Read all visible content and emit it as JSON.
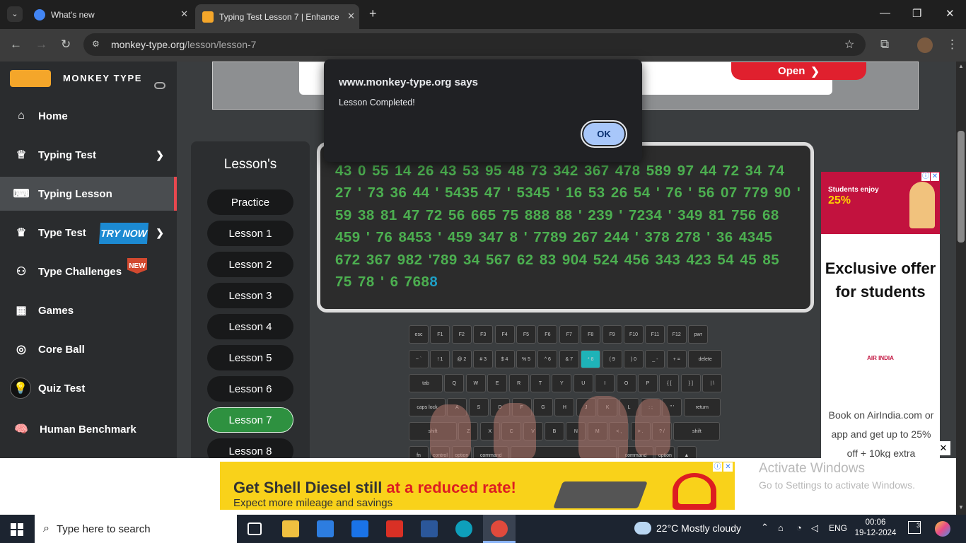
{
  "browser": {
    "tabs": [
      {
        "title": "What's new",
        "active": false
      },
      {
        "title": "Typing Test Lesson 7 | Enhance",
        "active": true
      }
    ],
    "url_host": "monkey-type.org",
    "url_path": "/lesson/lesson-7"
  },
  "sidebar": {
    "brand": "MONKEY TYPE",
    "items": [
      {
        "label": "Home",
        "icon": "home-icon"
      },
      {
        "label": "Typing Test",
        "icon": "trophy-icon"
      },
      {
        "label": "Typing Lesson",
        "icon": "keyboard-icon"
      },
      {
        "label": "Type Test",
        "icon": "crown-icon",
        "badge": "TRY NOW"
      },
      {
        "label": "Type Challenges",
        "icon": "medal-icon",
        "badge": "NEW"
      },
      {
        "label": "Games",
        "icon": "grid-icon"
      },
      {
        "label": "Core Ball",
        "icon": "target-icon"
      },
      {
        "label": "Quiz Test",
        "icon": "bulb-icon"
      },
      {
        "label": "Human Benchmark",
        "icon": "brain-icon"
      }
    ]
  },
  "top_ad": {
    "open_label": "Open"
  },
  "lessons": {
    "title": "Lesson's",
    "items": [
      "Practice",
      "Lesson 1",
      "Lesson 2",
      "Lesson 3",
      "Lesson 4",
      "Lesson 5",
      "Lesson 6",
      "Lesson 7",
      "Lesson 8"
    ],
    "active": "Lesson 7"
  },
  "typing": {
    "text": "43 0 55 14 26 43 53 95 48 73 342 367 478 589 97 44 72 34 74 27 ' 73 36 44 ' 5435 47 ' 5345 ' 16 53 26 54 ' 76 ' 56 07 779 90 ' 59 38 81 47 72 56 665 75 888 88 ' 239 ' 7234 ' 349 81 756 68 459 ' 76 8453 ' 459 347 8 ' 7789 267 244 ' 378 278 ' 36 4345 672 367 982 '789 34 567 62 83 904 524 456 343 423 54 45 85 75 78 ' 6 768",
    "cursor_char": "8"
  },
  "dialog": {
    "title": "www.monkey-type.org says",
    "message": "Lesson Completed!",
    "ok_label": "OK"
  },
  "right_ad": {
    "headline": "Exclusive offer for students",
    "brand": "AIR INDIA",
    "body": "Book on AirIndia.com or app and get up to 25% off + 10kg extra"
  },
  "bottom_ad": {
    "headline_a": "Get Shell Diesel still ",
    "headline_b": "at a reduced rate!",
    "sub": "Expect more mileage and savings"
  },
  "watermark": {
    "title": "Activate Windows",
    "sub": "Go to Settings to activate Windows."
  },
  "taskbar": {
    "search_placeholder": "Type here to search",
    "weather": "22°C  Mostly cloudy",
    "lang": "ENG",
    "time": "00:06",
    "date": "19-12-2024",
    "notifications": "3"
  }
}
